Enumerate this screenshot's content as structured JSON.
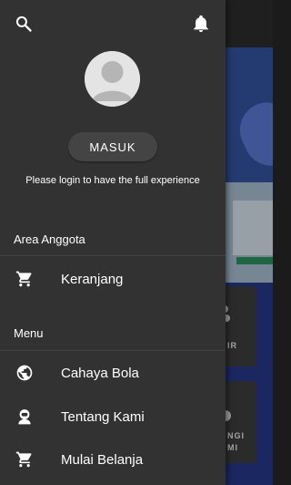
{
  "header": {
    "search_icon": "search-icon",
    "notification_icon": "bell-icon"
  },
  "profile": {
    "avatar_icon": "avatar-placeholder",
    "login_label": "MASUK",
    "hint": "Please login to have the full experience"
  },
  "sections": {
    "member": {
      "title": "Area Anggota",
      "items": [
        {
          "label": "Keranjang",
          "icon": "cart-icon"
        }
      ]
    },
    "menu": {
      "title": "Menu",
      "items": [
        {
          "label": "Cahaya Bola",
          "icon": "globe-icon"
        },
        {
          "label": "Tentang Kami",
          "icon": "person-icon"
        },
        {
          "label": "Mulai Belanja",
          "icon": "cart-icon"
        }
      ]
    }
  },
  "background": {
    "card1_text": "IR",
    "card2_text": "NGI\nMI"
  },
  "colors": {
    "drawer_bg": "#323232",
    "text": "#ffffff",
    "button_bg": "#444444",
    "divider": "#444444"
  }
}
